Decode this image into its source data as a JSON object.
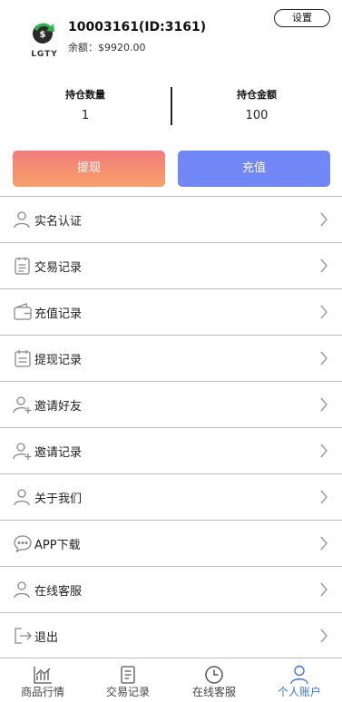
{
  "profile": {
    "logo_text": "LGTY",
    "user_id": "10003161(ID:3161)",
    "balance": "余额：$9920.00",
    "settings_label": "设置"
  },
  "stats": {
    "qty_label": "持仓数量",
    "qty_value": "1",
    "amount_label": "持仓金额",
    "amount_value": "100"
  },
  "actions": {
    "withdraw": "提现",
    "recharge": "充值"
  },
  "menu": [
    {
      "label": "实名认证",
      "icon": "user-icon"
    },
    {
      "label": "交易记录",
      "icon": "clipboard-icon"
    },
    {
      "label": "充值记录",
      "icon": "wallet-icon"
    },
    {
      "label": "提现记录",
      "icon": "calendar-icon"
    },
    {
      "label": "邀请好友",
      "icon": "user-add-icon"
    },
    {
      "label": "邀请记录",
      "icon": "user-add-icon"
    },
    {
      "label": "关于我们",
      "icon": "user-icon"
    },
    {
      "label": "APP下载",
      "icon": "chat-icon"
    },
    {
      "label": "在线客服",
      "icon": "user-icon"
    },
    {
      "label": "退出",
      "icon": "logout-icon"
    }
  ],
  "tabbar": [
    {
      "label": "商品行情",
      "icon": "chart-icon"
    },
    {
      "label": "交易记录",
      "icon": "document-icon"
    },
    {
      "label": "在线客服",
      "icon": "clock-icon"
    },
    {
      "label": "个人账户",
      "icon": "person-icon",
      "active": true
    }
  ],
  "colors": {
    "accent": "#3a77d8",
    "withdraw_start": "#f27c7c",
    "withdraw_end": "#f6a06a",
    "recharge": "#7187f5"
  }
}
